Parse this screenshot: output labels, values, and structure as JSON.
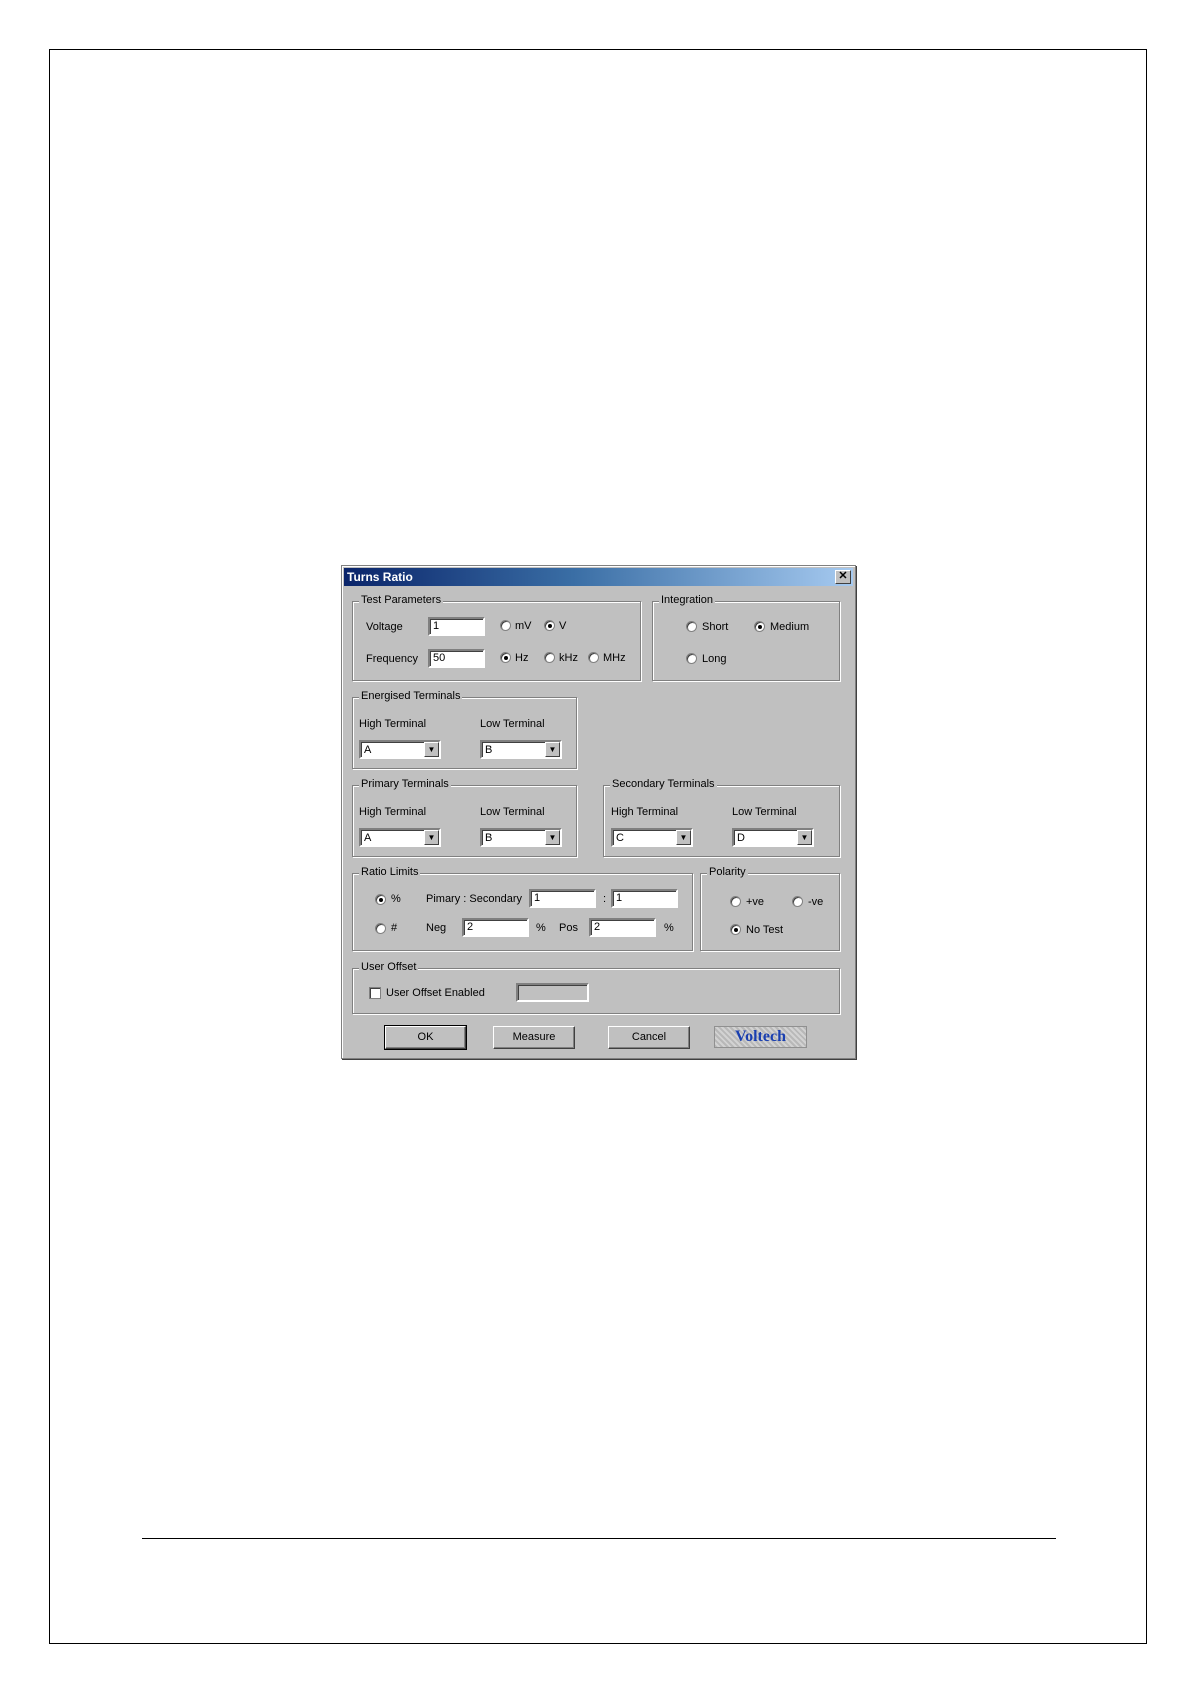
{
  "dialog": {
    "title": "Turns Ratio",
    "close_glyph": "✕",
    "test_parameters": {
      "legend": "Test Parameters",
      "voltage_label": "Voltage",
      "voltage_value": "1",
      "voltage_units": [
        "mV",
        "V"
      ],
      "voltage_selected": "V",
      "frequency_label": "Frequency",
      "frequency_value": "50",
      "frequency_units": [
        "Hz",
        "kHz",
        "MHz"
      ],
      "frequency_selected": "Hz"
    },
    "integration": {
      "legend": "Integration",
      "options": [
        "Short",
        "Medium",
        "Long"
      ],
      "selected": "Medium"
    },
    "energised_terminals": {
      "legend": "Energised Terminals",
      "high_label": "High Terminal",
      "high_value": "A",
      "low_label": "Low Terminal",
      "low_value": "B"
    },
    "primary_terminals": {
      "legend": "Primary Terminals",
      "high_label": "High Terminal",
      "high_value": "A",
      "low_label": "Low Terminal",
      "low_value": "B"
    },
    "secondary_terminals": {
      "legend": "Secondary Terminals",
      "high_label": "High Terminal",
      "high_value": "C",
      "low_label": "Low Terminal",
      "low_value": "D"
    },
    "ratio_limits": {
      "legend": "Ratio Limits",
      "mode_percent": "%",
      "mode_count": "#",
      "selected_mode": "%",
      "ratio_label": "Pimary : Secondary",
      "primary_value": "1",
      "separator": ":",
      "secondary_value": "1",
      "neg_label": "Neg",
      "neg_value": "2",
      "neg_unit": "%",
      "pos_label": "Pos",
      "pos_value": "2",
      "pos_unit": "%"
    },
    "polarity": {
      "legend": "Polarity",
      "options": [
        "+ve",
        "-ve",
        "No Test"
      ],
      "selected": "No Test"
    },
    "user_offset": {
      "legend": "User Offset",
      "checkbox_label": "User Offset Enabled",
      "enabled": false,
      "value": ""
    },
    "buttons": {
      "ok": "OK",
      "measure": "Measure",
      "cancel": "Cancel"
    },
    "logo_text": "Voltech",
    "dropdown_glyph": "▼"
  }
}
